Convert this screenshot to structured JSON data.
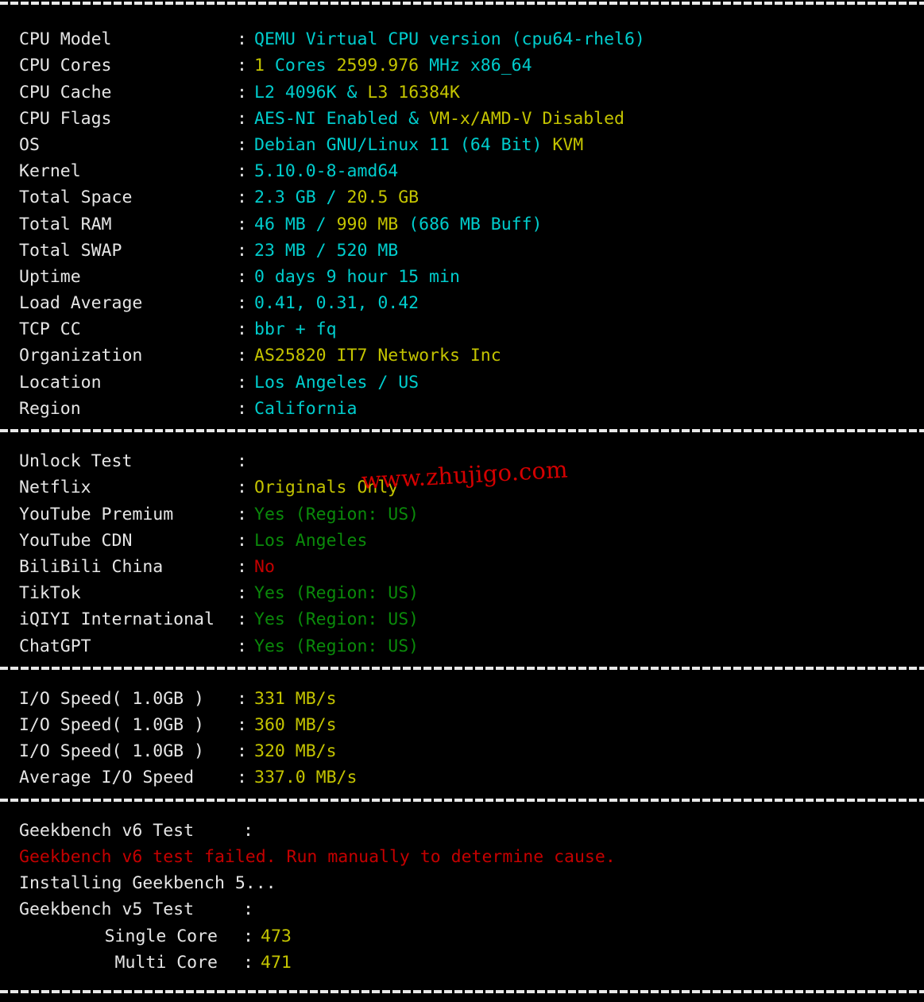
{
  "terminal": {
    "background_color": "#000000",
    "palette": {
      "white": "#e6e6e6",
      "cyan": "#00cdcd",
      "yellow": "#c4c400",
      "green": "#0a8a0a",
      "red": "#c40000"
    },
    "separator_char": "-"
  },
  "watermark": {
    "text": "www.zhujigo.com",
    "color": "#d40000"
  },
  "sections": {
    "system_info": {
      "rows": [
        {
          "label": "CPU Model",
          "colon": ":",
          "parts": [
            {
              "text": "QEMU Virtual CPU version (cpu64-rhel6)",
              "color": "cyan"
            }
          ]
        },
        {
          "label": "CPU Cores",
          "colon": ":",
          "parts": [
            {
              "text": "1",
              "color": "yellow"
            },
            {
              "text": " Cores ",
              "color": "cyan"
            },
            {
              "text": "2599.976",
              "color": "yellow"
            },
            {
              "text": " MHz ",
              "color": "cyan"
            },
            {
              "text": "x86_64",
              "color": "cyan"
            }
          ]
        },
        {
          "label": "CPU Cache",
          "colon": ":",
          "parts": [
            {
              "text": "L2 ",
              "color": "cyan"
            },
            {
              "text": "4096K",
              "color": "cyan"
            },
            {
              "text": " & ",
              "color": "cyan"
            },
            {
              "text": "L3 16384K",
              "color": "yellow"
            }
          ]
        },
        {
          "label": "CPU Flags",
          "colon": ":",
          "parts": [
            {
              "text": "AES-NI Enabled",
              "color": "cyan"
            },
            {
              "text": " & ",
              "color": "cyan"
            },
            {
              "text": "VM-x/AMD-V Disabled",
              "color": "yellow"
            }
          ]
        },
        {
          "label": "OS",
          "colon": ":",
          "parts": [
            {
              "text": "Debian GNU/Linux 11 (64 Bit) ",
              "color": "cyan"
            },
            {
              "text": "KVM",
              "color": "yellow"
            }
          ]
        },
        {
          "label": "Kernel",
          "colon": ":",
          "parts": [
            {
              "text": "5.10.0-8-amd64",
              "color": "cyan"
            }
          ]
        },
        {
          "label": "Total Space",
          "colon": ":",
          "parts": [
            {
              "text": "2.3 GB",
              "color": "cyan"
            },
            {
              "text": " / ",
              "color": "cyan"
            },
            {
              "text": "20.5 GB",
              "color": "yellow"
            }
          ]
        },
        {
          "label": "Total RAM",
          "colon": ":",
          "parts": [
            {
              "text": "46 MB",
              "color": "cyan"
            },
            {
              "text": " / ",
              "color": "cyan"
            },
            {
              "text": "990 MB",
              "color": "yellow"
            },
            {
              "text": " (686 MB Buff)",
              "color": "cyan"
            }
          ]
        },
        {
          "label": "Total SWAP",
          "colon": ":",
          "parts": [
            {
              "text": "23 MB / 520 MB",
              "color": "cyan"
            }
          ]
        },
        {
          "label": "Uptime",
          "colon": ":",
          "parts": [
            {
              "text": "0 days 9 hour 15 min",
              "color": "cyan"
            }
          ]
        },
        {
          "label": "Load Average",
          "colon": ":",
          "parts": [
            {
              "text": "0.41, 0.31, 0.42",
              "color": "cyan"
            }
          ]
        },
        {
          "label": "TCP CC",
          "colon": ":",
          "parts": [
            {
              "text": "bbr + fq",
              "color": "cyan"
            }
          ]
        },
        {
          "label": "Organization",
          "colon": ":",
          "parts": [
            {
              "text": "AS25820 IT7 Networks Inc",
              "color": "yellow"
            }
          ]
        },
        {
          "label": "Location",
          "colon": ":",
          "parts": [
            {
              "text": "Los Angeles / US",
              "color": "cyan"
            }
          ]
        },
        {
          "label": "Region",
          "colon": ":",
          "parts": [
            {
              "text": "California",
              "color": "cyan"
            }
          ]
        }
      ]
    },
    "unlock_test": {
      "rows": [
        {
          "label": "Unlock Test",
          "colon": ":",
          "parts": []
        },
        {
          "label": "Netflix",
          "colon": ":",
          "parts": [
            {
              "text": "Originals Only",
              "color": "yellow"
            }
          ]
        },
        {
          "label": "YouTube Premium",
          "colon": ":",
          "parts": [
            {
              "text": "Yes (Region: US)",
              "color": "green"
            }
          ]
        },
        {
          "label": "YouTube CDN",
          "colon": ":",
          "parts": [
            {
              "text": "Los Angeles",
              "color": "green"
            }
          ]
        },
        {
          "label": "BiliBili China",
          "colon": ":",
          "parts": [
            {
              "text": "No",
              "color": "red"
            }
          ]
        },
        {
          "label": "TikTok",
          "colon": ":",
          "parts": [
            {
              "text": "Yes (Region: US)",
              "color": "green"
            }
          ]
        },
        {
          "label": "iQIYI International",
          "colon": ":",
          "parts": [
            {
              "text": "Yes (Region: US)",
              "color": "green"
            }
          ]
        },
        {
          "label": "ChatGPT",
          "colon": ":",
          "parts": [
            {
              "text": "Yes (Region: US)",
              "color": "green"
            }
          ]
        }
      ]
    },
    "io_speed": {
      "rows": [
        {
          "label": "I/O Speed( 1.0GB )",
          "colon": ":",
          "parts": [
            {
              "text": "331 MB/s",
              "color": "yellow"
            }
          ]
        },
        {
          "label": "I/O Speed( 1.0GB )",
          "colon": ":",
          "parts": [
            {
              "text": "360 MB/s",
              "color": "yellow"
            }
          ]
        },
        {
          "label": "I/O Speed( 1.0GB )",
          "colon": ":",
          "parts": [
            {
              "text": "320 MB/s",
              "color": "yellow"
            }
          ]
        },
        {
          "label": "Average I/O Speed",
          "colon": ":",
          "parts": [
            {
              "text": "337.0 MB/s",
              "color": "yellow"
            }
          ]
        }
      ]
    },
    "geekbench": {
      "rows": [
        {
          "label": "Geekbench v6 Test",
          "colon": ":",
          "parts": []
        }
      ],
      "error_line": "Geekbench v6 test failed. Run manually to determine cause.",
      "installing_line": "Installing Geekbench 5...",
      "v5_rows": [
        {
          "label": "Geekbench v5 Test",
          "colon": ":",
          "parts": []
        },
        {
          "label": "Single Core",
          "colon": ":",
          "indent": true,
          "parts": [
            {
              "text": "473",
              "color": "yellow"
            }
          ]
        },
        {
          "label": "Multi Core",
          "colon": ":",
          "indent": true,
          "parts": [
            {
              "text": "471",
              "color": "yellow"
            }
          ]
        }
      ]
    }
  }
}
